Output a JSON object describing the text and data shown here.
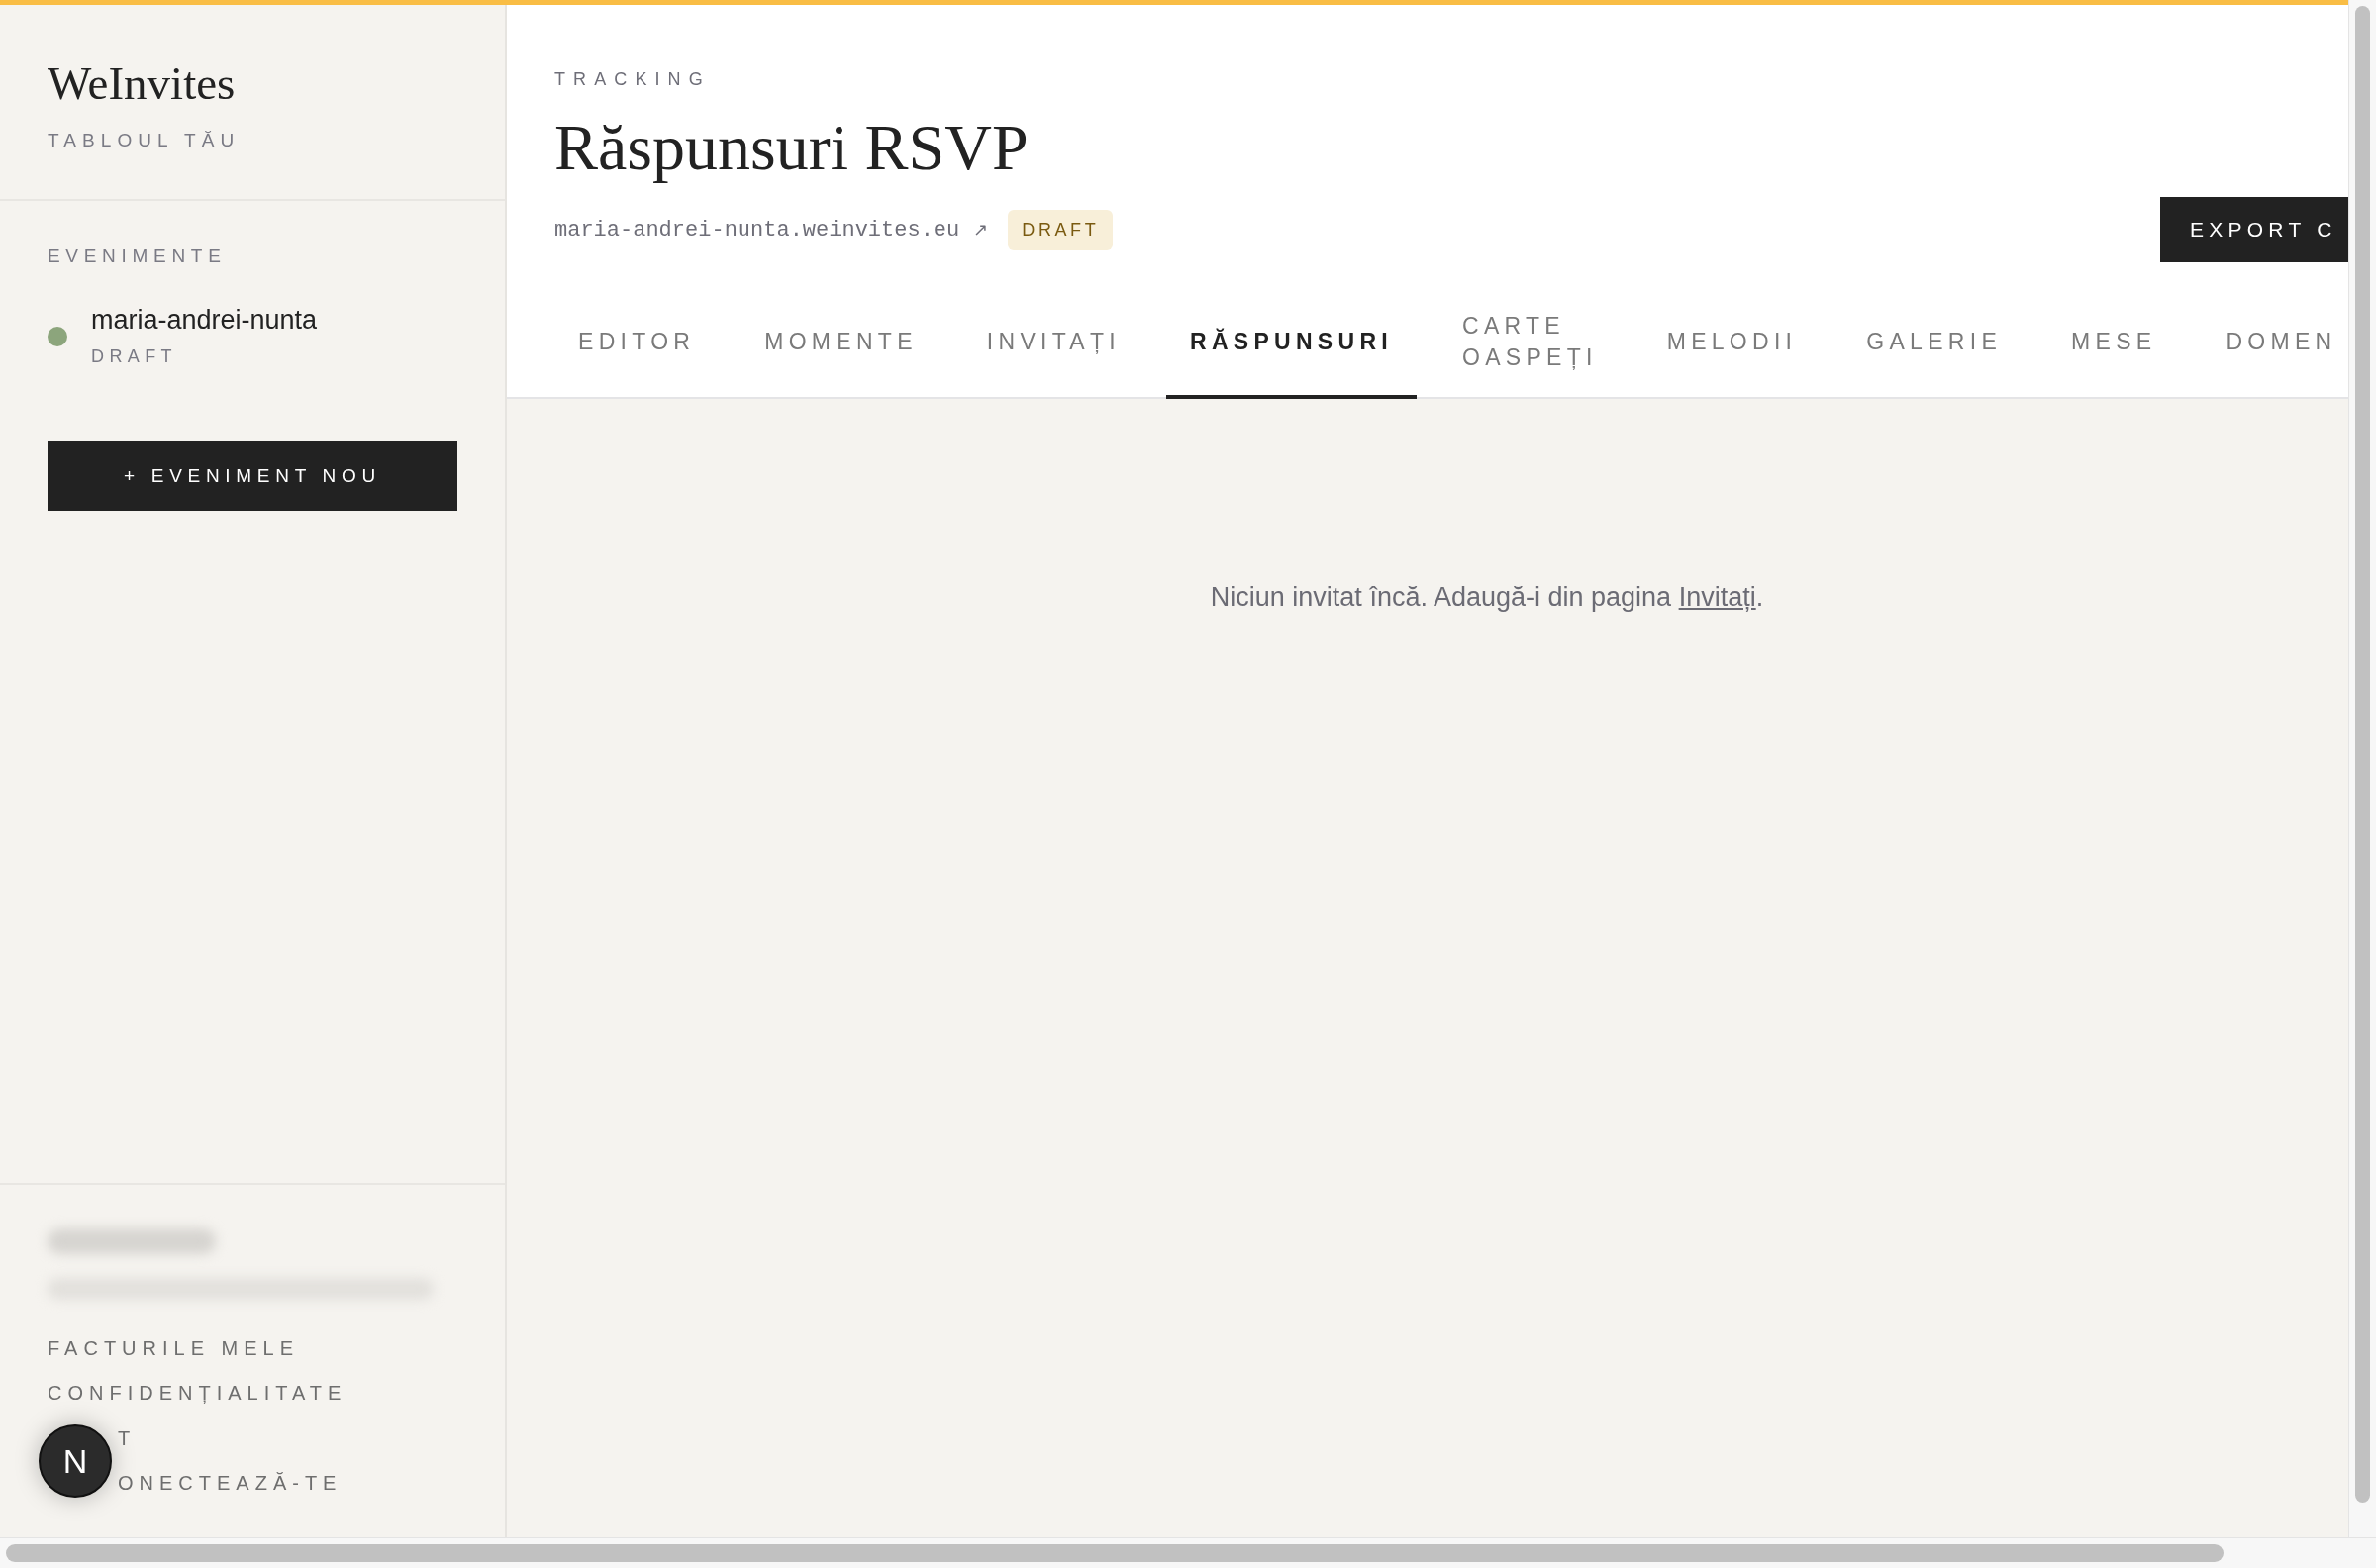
{
  "app": {
    "logo": "WeInvites",
    "subtitle": "TABLOUL TĂU"
  },
  "sidebar": {
    "section_title": "EVENIMENTE",
    "events": [
      {
        "name": "maria-andrei-nunta",
        "status": "DRAFT",
        "color": "#8ca57c"
      }
    ],
    "new_event_button": "+ EVENIMENT NOU",
    "links": [
      "FACTURILE MELE",
      "CONFIDENȚIALITATE"
    ],
    "links_behind_badge": [
      "T",
      "ONECTEAZĂ-TE"
    ]
  },
  "dev_badge": "N",
  "header": {
    "eyebrow": "TRACKING",
    "title": "Răspunsuri RSVP",
    "url": "maria-andrei-nunta.weinvites.eu",
    "url_arrow": "↗",
    "status_badge": "DRAFT",
    "export_button": "EXPORT C"
  },
  "tabs": [
    {
      "label": "EDITOR",
      "selected": false
    },
    {
      "label": "MOMENTE",
      "selected": false
    },
    {
      "label": "INVITAȚI",
      "selected": false
    },
    {
      "label": "RĂSPUNSURI",
      "selected": true
    },
    {
      "label": "CARTE OASPEȚI",
      "selected": false
    },
    {
      "label": "MELODII",
      "selected": false
    },
    {
      "label": "GALERIE",
      "selected": false
    },
    {
      "label": "MESE",
      "selected": false
    },
    {
      "label": "DOMEN",
      "selected": false
    }
  ],
  "empty_state": {
    "text": "Niciun invitat încă. Adaugă-i din pagina ",
    "link": "Invitați",
    "end": "."
  }
}
